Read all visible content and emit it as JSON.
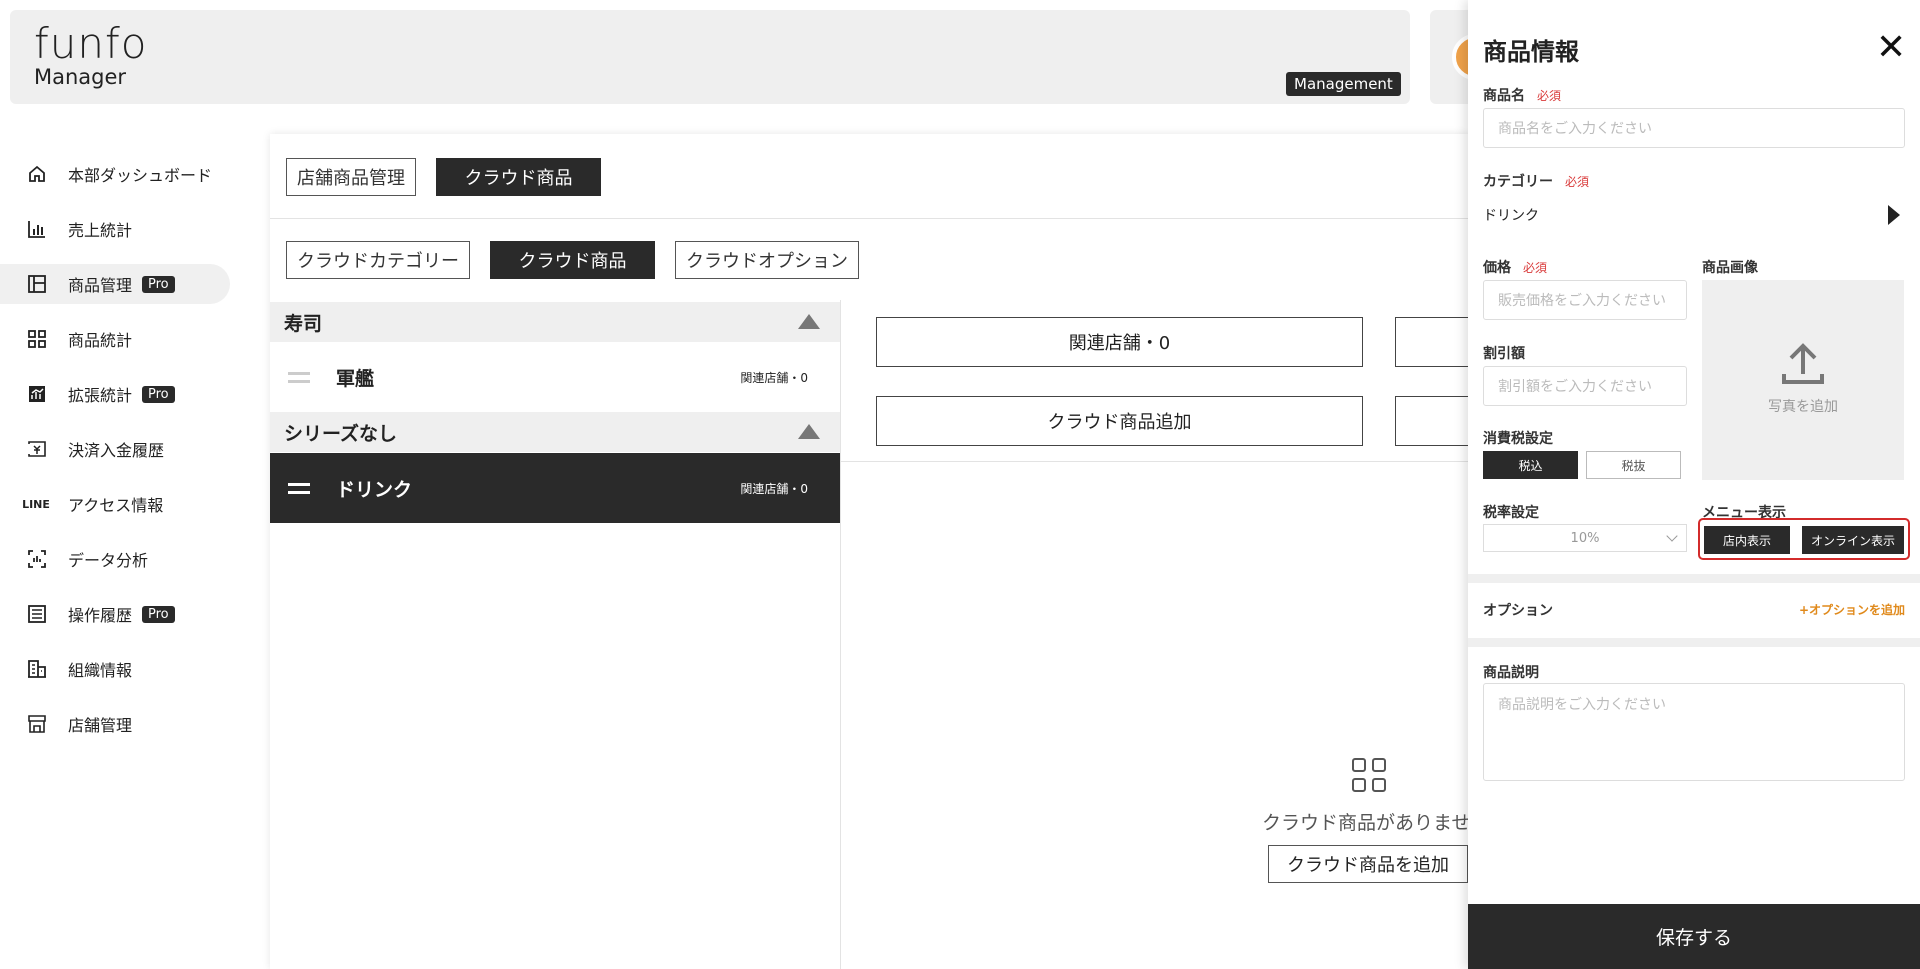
{
  "header": {
    "logo_main": "funfo",
    "logo_sub": "Manager",
    "badge": "Management"
  },
  "sidebar": {
    "items": [
      {
        "label": "本部ダッシュボード",
        "icon": "home-icon"
      },
      {
        "label": "売上統計",
        "icon": "bar-chart-icon"
      },
      {
        "label": "商品管理",
        "icon": "layout-icon",
        "badge": "Pro"
      },
      {
        "label": "商品統計",
        "icon": "grid-icon"
      },
      {
        "label": "拡張統計",
        "icon": "analytics-icon",
        "badge": "Pro"
      },
      {
        "label": "決済入金履歴",
        "icon": "payment-icon"
      },
      {
        "label": "アクセス情報",
        "icon": "line-icon",
        "icon_text": "LINE"
      },
      {
        "label": "データ分析",
        "icon": "scan-icon"
      },
      {
        "label": "操作履歴",
        "icon": "list-icon",
        "badge": "Pro"
      },
      {
        "label": "組織情報",
        "icon": "building-icon"
      },
      {
        "label": "店舗管理",
        "icon": "store-icon"
      }
    ]
  },
  "main": {
    "top_tabs": [
      "店舗商品管理",
      "クラウド商品"
    ],
    "sub_tabs": [
      "クラウドカテゴリー",
      "クラウド商品",
      "クラウドオプション"
    ],
    "groups": [
      {
        "name": "寿司",
        "rows": [
          {
            "name": "軍艦",
            "meta": "関連店舗・0"
          }
        ]
      },
      {
        "name": "シリーズなし",
        "rows": [
          {
            "name": "ドリンク",
            "meta": "関連店舗・0"
          }
        ]
      }
    ],
    "related_button": "関連店舗・0",
    "add_button": "クラウド商品追加",
    "empty_text": "クラウド商品がありません",
    "empty_add_button": "クラウド商品を追加"
  },
  "panel": {
    "title": "商品情報",
    "close_icon": "close-icon",
    "required": "必須",
    "name_label": "商品名",
    "name_placeholder": "商品名をご入力ください",
    "category_label": "カテゴリー",
    "category_value": "ドリンク",
    "price_label": "価格",
    "price_placeholder": "販売価格をご入力ください",
    "image_label": "商品画像",
    "upload_text": "写真を追加",
    "discount_label": "割引額",
    "discount_placeholder": "割引額をご入力ください",
    "tax_label": "消費税設定",
    "tax_options": [
      "税込",
      "税抜"
    ],
    "rate_label": "税率設定",
    "rate_value": "10%",
    "menu_label": "メニュー表示",
    "menu_options": [
      "店内表示",
      "オンライン表示"
    ],
    "option_label": "オプション",
    "add_option": "+オプションを追加",
    "desc_label": "商品説明",
    "desc_placeholder": "商品説明をご入力ください",
    "save": "保存する"
  }
}
